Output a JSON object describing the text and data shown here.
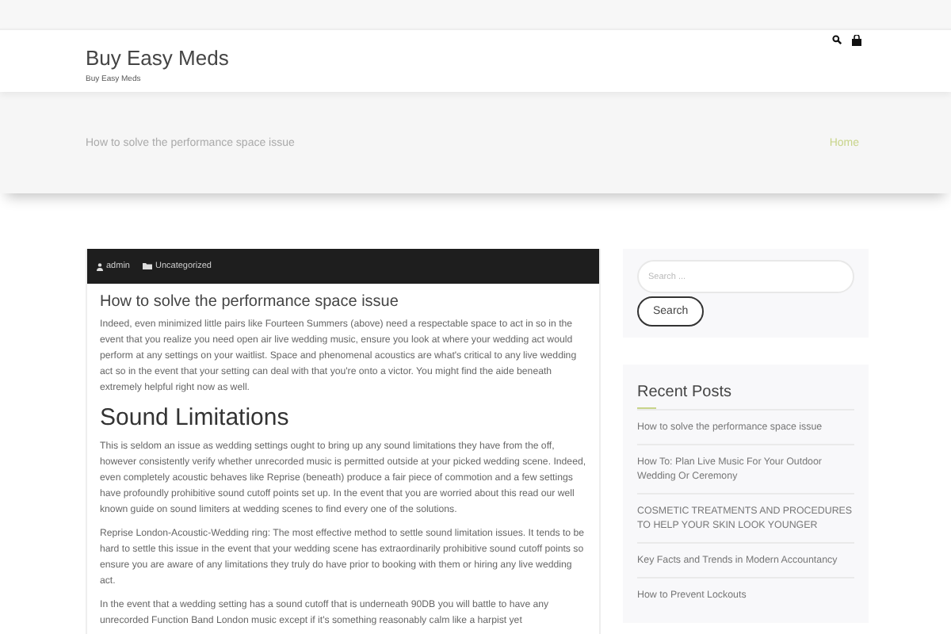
{
  "site": {
    "title": "Buy Easy Meds",
    "tagline": "Buy Easy Meds"
  },
  "banner": {
    "page_title": "How to solve the performance space issue",
    "breadcrumb": "Home"
  },
  "post": {
    "author": "admin",
    "category": "Uncategorized",
    "title": "How to solve the performance space issue",
    "intro": "Indeed, even minimized little pairs like Fourteen Summers (above) need a respectable space to act in so in the event that you realize you need open air live wedding music, ensure you look at where your wedding act would perform at any settings on your waitlist. Space and phenomenal acoustics are what's critical to any live wedding act so in the event that your setting can deal with that you're onto a victor. You might find the aide beneath extremely helpful right now as well.",
    "heading": "Sound Limitations",
    "paragraphs": [
      "This is seldom an issue as wedding settings ought to bring up any sound limitations they have from the off, however consistently verify whether unrecorded music is permitted outside at your picked wedding scene. Indeed, even completely acoustic behaves like Reprise (beneath) produce a fair piece of commotion and a few settings have profoundly prohibitive sound cutoff points set up. In the event that you are worried about this read our well known guide on sound limiters at wedding scenes to find every one of the solutions.",
      "Reprise London-Acoustic-Wedding ring: The most effective method to settle sound limitation issues. It tends to be hard to settle this issue in the event that your wedding scene has extraordinarily prohibitive sound cutoff points so ensure you are aware of any limitations they truly do have prior to booking with them or hiring any live wedding act.",
      "In the event that a wedding setting has a sound cutoff that is underneath 90DB you will battle to have any unrecorded Function Band London music except if it's something reasonably calm like a harpist yet"
    ]
  },
  "sidebar": {
    "search": {
      "placeholder": "Search ...",
      "button": "Search"
    },
    "recent_posts": {
      "title": "Recent Posts",
      "items": [
        "How to solve the performance space issue",
        "How To: Plan Live Music For Your Outdoor Wedding Or Ceremony",
        "COSMETIC TREATMENTS AND PROCEDURES TO HELP YOUR SKIN LOOK YOUNGER",
        "Key Facts and Trends in Modern Accountancy",
        "How to Prevent Lockouts"
      ]
    }
  }
}
